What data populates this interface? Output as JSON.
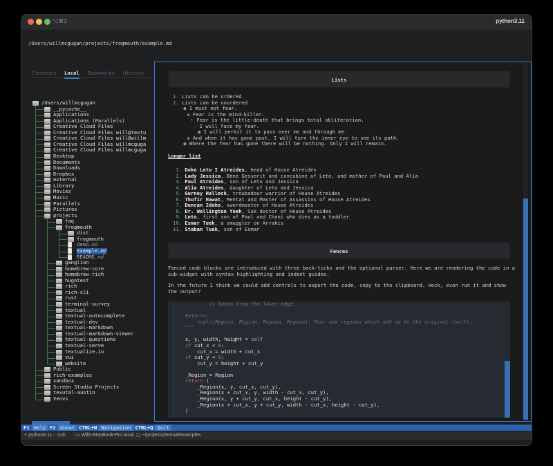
{
  "window": {
    "shortcut": "⌥⌘3",
    "title": "python3.11",
    "colors": {
      "close": "#ed6a5e",
      "minimize": "#f5bf4f",
      "zoom": "#61c554",
      "accent": "#3a78c7"
    }
  },
  "path": "/Users/willmcgugan/projects/frogmouth/example.md",
  "tabs": [
    {
      "label": "Contents",
      "active": false
    },
    {
      "label": "Local",
      "active": true
    },
    {
      "label": "Bookmarks",
      "active": false
    },
    {
      "label": "History",
      "active": false
    }
  ],
  "tree": [
    {
      "label": "/Users/willmcgugan",
      "level": 0,
      "type": "folder-open"
    },
    {
      "label": "__pycache__",
      "level": 1,
      "type": "folder"
    },
    {
      "label": "Applications",
      "level": 1,
      "type": "folder"
    },
    {
      "label": "Applications (Parallels)",
      "level": 1,
      "type": "folder"
    },
    {
      "label": "Creative Cloud Files",
      "level": 1,
      "type": "folder"
    },
    {
      "label": "Creative Cloud Files will@textu",
      "level": 1,
      "type": "folder"
    },
    {
      "label": "Creative Cloud Files will@willm",
      "level": 1,
      "type": "folder"
    },
    {
      "label": "Creative Cloud Files willmcguga",
      "level": 1,
      "type": "folder"
    },
    {
      "label": "Creative Cloud Files willmcguga",
      "level": 1,
      "type": "folder"
    },
    {
      "label": "Desktop",
      "level": 1,
      "type": "folder"
    },
    {
      "label": "Documents",
      "level": 1,
      "type": "folder"
    },
    {
      "label": "Downloads",
      "level": 1,
      "type": "folder"
    },
    {
      "label": "Dropbox",
      "level": 1,
      "type": "folder"
    },
    {
      "label": "external",
      "level": 1,
      "type": "folder"
    },
    {
      "label": "Library",
      "level": 1,
      "type": "folder"
    },
    {
      "label": "Movies",
      "level": 1,
      "type": "folder"
    },
    {
      "label": "Music",
      "level": 1,
      "type": "folder"
    },
    {
      "label": "Parallels",
      "level": 1,
      "type": "folder"
    },
    {
      "label": "Pictures",
      "level": 1,
      "type": "folder"
    },
    {
      "label": "projects",
      "level": 1,
      "type": "folder-open"
    },
    {
      "label": "faq",
      "level": 2,
      "type": "folder"
    },
    {
      "label": "frogmouth",
      "level": 2,
      "type": "folder-open"
    },
    {
      "label": "dist",
      "level": 3,
      "type": "folder"
    },
    {
      "label": "frogmouth",
      "level": 3,
      "type": "folder"
    },
    {
      "label": "demo.md",
      "level": 3,
      "type": "file"
    },
    {
      "label": "example.md",
      "level": 3,
      "type": "file",
      "selected": true
    },
    {
      "label": "README.md",
      "level": 3,
      "type": "file"
    },
    {
      "label": "ganglion",
      "level": 2,
      "type": "folder"
    },
    {
      "label": "homebrew-core",
      "level": 2,
      "type": "folder"
    },
    {
      "label": "homebrew-rich",
      "level": 2,
      "type": "folder"
    },
    {
      "label": "hugotest",
      "level": 2,
      "type": "folder"
    },
    {
      "label": "rich",
      "level": 2,
      "type": "folder"
    },
    {
      "label": "rich-cli",
      "level": 2,
      "type": "folder"
    },
    {
      "label": "rust",
      "level": 2,
      "type": "folder"
    },
    {
      "label": "terminal-survey",
      "level": 2,
      "type": "folder"
    },
    {
      "label": "textual",
      "level": 2,
      "type": "folder"
    },
    {
      "label": "textual-autocomplete",
      "level": 2,
      "type": "folder"
    },
    {
      "label": "textual-dev",
      "level": 2,
      "type": "folder"
    },
    {
      "label": "textual-markdown",
      "level": 2,
      "type": "folder"
    },
    {
      "label": "textual-markdown-viewer",
      "level": 2,
      "type": "folder"
    },
    {
      "label": "textual-questions",
      "level": 2,
      "type": "folder"
    },
    {
      "label": "textual-serve",
      "level": 2,
      "type": "folder"
    },
    {
      "label": "textualize.io",
      "level": 2,
      "type": "folder"
    },
    {
      "label": "vui",
      "level": 2,
      "type": "folder"
    },
    {
      "label": "website",
      "level": 2,
      "type": "folder"
    },
    {
      "label": "Public",
      "level": 1,
      "type": "folder"
    },
    {
      "label": "rich-examples",
      "level": 1,
      "type": "folder"
    },
    {
      "label": "sandbox",
      "level": 1,
      "type": "folder"
    },
    {
      "label": "Screen Studio Projects",
      "level": 1,
      "type": "folder"
    },
    {
      "label": "texutal-austin",
      "level": 1,
      "type": "folder"
    },
    {
      "label": "Venvs",
      "level": 1,
      "type": "folder"
    }
  ],
  "tree_hscroll_fraction": 0.34,
  "doc": {
    "lists_heading": "Lists",
    "lists": [
      {
        "marker": "1.",
        "indent": 0,
        "text": "Lists can be ordered"
      },
      {
        "marker": "2.",
        "indent": 0,
        "text": "Lists can be unordered"
      },
      {
        "marker": "●",
        "indent": 1,
        "text": "I must not fear."
      },
      {
        "marker": "▪",
        "indent": 2,
        "text": "Fear is the mind-killer."
      },
      {
        "marker": "‣",
        "indent": 3,
        "text": "Fear is the little-death that brings total obliteration."
      },
      {
        "marker": "⁃",
        "indent": 4,
        "text": "I will face my fear."
      },
      {
        "marker": "●",
        "indent": 5,
        "text": "I will permit it to pass over me and through me."
      },
      {
        "marker": "▪",
        "indent": 2,
        "text": "And when it has gone past, I will turn the inner eye to see its path."
      },
      {
        "marker": "●",
        "indent": 1,
        "text": "Where the fear has gone there will be nothing. Only I will remain."
      }
    ],
    "longer_heading": "Longer list",
    "longer": [
      {
        "n": "1.",
        "name": "Duke Leto I Atreides",
        "rest": ", head of House Atreides"
      },
      {
        "n": "2.",
        "name": "Lady Jessica",
        "rest": ", Bene Gesserit and concubine of Leto, and mother of Paul and Alia"
      },
      {
        "n": "3.",
        "name": "Paul Atreides",
        "rest": ", son of Leto and Jessica"
      },
      {
        "n": "4.",
        "name": "Alia Atreides",
        "rest": ", daughter of Leto and Jessica"
      },
      {
        "n": "5.",
        "name": "Gurney Halleck",
        "rest": ", troubadour warrior of House Atreides"
      },
      {
        "n": "6.",
        "name": "Thufir Hawat",
        "rest": ", Mentat and Master of Assassins of House Atreides"
      },
      {
        "n": "7.",
        "name": "Duncan Idaho",
        "rest": ", swordmaster of House Atreides"
      },
      {
        "n": "8.",
        "name": "Dr. Wellington Yueh",
        "rest": ", Suk doctor of House Atreides"
      },
      {
        "n": "9.",
        "name": "Leto",
        "rest": ", first son of Paul and Chani who dies as a toddler"
      },
      {
        "n": "10.",
        "name": "Esmar Tuek",
        "rest": ", a smuggler on Arrakis"
      },
      {
        "n": "11.",
        "name": "Staban Tuek",
        "rest": ", son of Esmar"
      }
    ],
    "fences_heading": "Fences",
    "para1_l1": "Fenced code blocks are introduced with three back-ticks and the optional parser. Here we are rendering the code in a",
    "para1_l2": "sub-widget with syntax highlighting and indent guides.",
    "para2_l1": "In the future I think we could add controls to export the code, copy to the clipboard. Heck, even run it and show",
    "para2_l2": "the output?",
    "code": [
      "        is taken from the lower edge.",
      "",
      "Returns:",
      "    tuple[Region, Region, Region, Region]: Four new regions which add up to the original (self).",
      "\"\"\"",
      "",
      "x, y, width, height = self",
      "if cut_x < 0:",
      "    cut_x = width + cut_x",
      "if cut_y < 0:",
      "    cut_y = height + cut_y",
      "",
      "_Region = Region",
      "return (",
      "    _Region(x, y, cut_x, cut_y),",
      "    _Region(x + cut_x, y, width - cut_x, cut_y),",
      "    _Region(x, y + cut_y, cut_x, height - cut_y),",
      "    _Region(x + cut_x, y + cut_y, width - cut_x, height - cut_y),",
      ")"
    ]
  },
  "footer": [
    {
      "key": "F1",
      "label": "Help"
    },
    {
      "key": "F2",
      "label": "About"
    },
    {
      "key": "CTRL+N",
      "label": "Navigation"
    },
    {
      "key": "CTRL+Q",
      "label": "Quit"
    }
  ],
  "status": {
    "shell": "python3.11 - -zsh",
    "host": "Wills-MacBook-Pro.local",
    "cwd": "~/projects/textual/examples"
  }
}
